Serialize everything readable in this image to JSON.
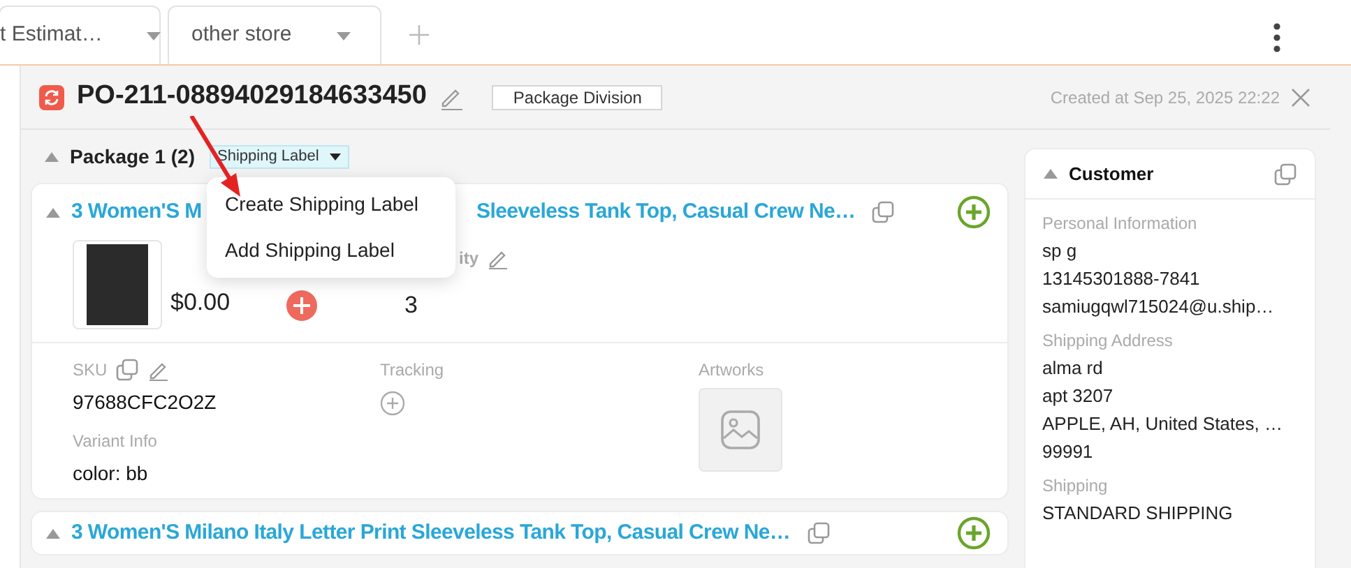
{
  "tabs": [
    {
      "label": "t Estimat…"
    },
    {
      "label": "other store"
    }
  ],
  "order": {
    "id": "PO-211-08894029184633450",
    "badge": "Package Division",
    "created": "Created at Sep 25, 2025 22:22"
  },
  "package": {
    "title": "Package 1 (2)",
    "expanded": true,
    "label_button": "Shipping Label"
  },
  "menu": {
    "items": [
      "Create Shipping Label",
      "Add Shipping Label"
    ]
  },
  "items": [
    {
      "expanded": true,
      "title_start": "3 Women'S M",
      "title_end": "Sleeveless Tank Top, Casual Crew Ne…",
      "price": "$0.00",
      "quantity_label": "ity",
      "quantity": "3",
      "sku_label": "SKU",
      "sku": "97688CFC2O2Z",
      "tracking_label": "Tracking",
      "artworks_label": "Artworks",
      "variant_label": "Variant Info",
      "variant": "color: bb"
    },
    {
      "expanded": true,
      "title_start": "3 Women'S Milano Italy Letter Print Sleeveless Tank Top, Casual Crew Ne…"
    }
  ],
  "customer": {
    "title": "Customer",
    "expanded": true,
    "sections": [
      {
        "heading": "Personal Information",
        "lines": [
          "sp g",
          "13145301888-7841",
          "samiugqwl715024@u.ship…"
        ]
      },
      {
        "heading": "Shipping Address",
        "lines": [
          "alma rd",
          "apt 3207",
          "APPLE, AH, United States, …",
          "99991"
        ]
      },
      {
        "heading": "Shipping",
        "lines": [
          "STANDARD SHIPPING"
        ]
      }
    ]
  }
}
